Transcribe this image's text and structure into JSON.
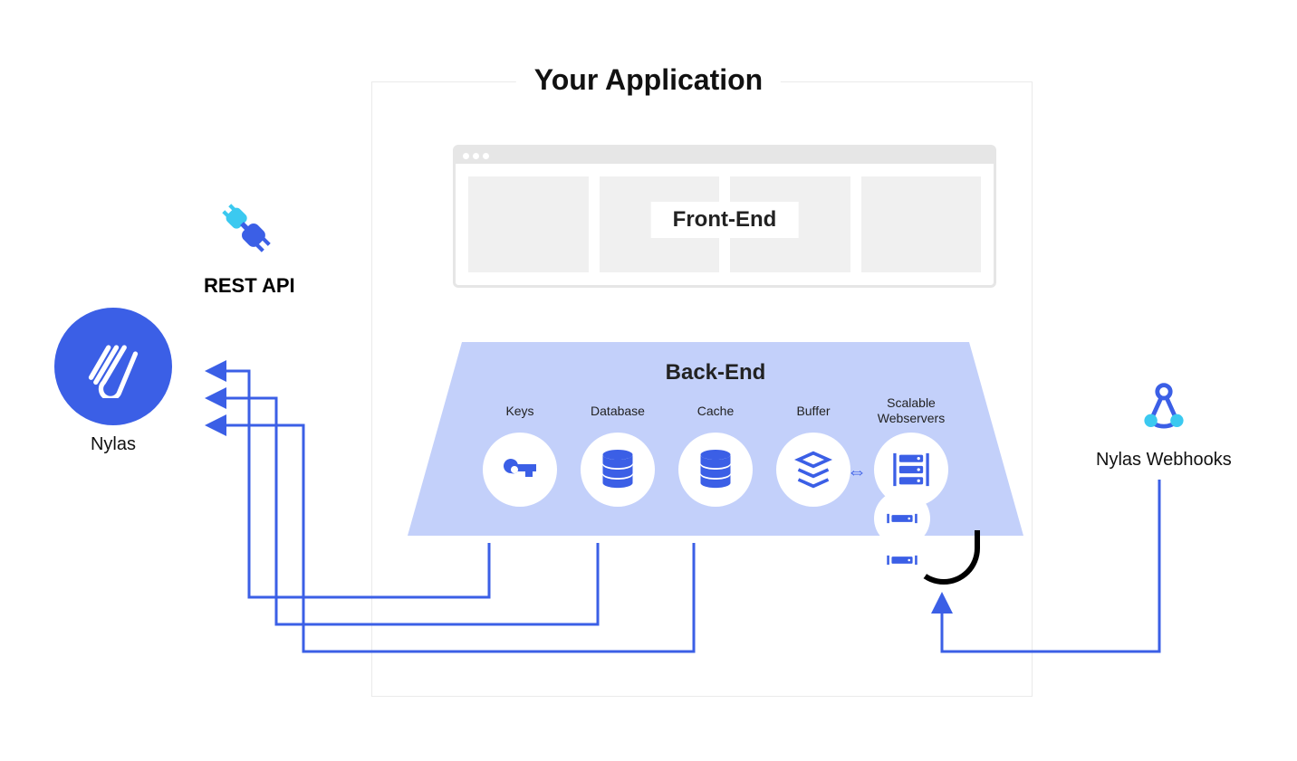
{
  "title": "Your Application",
  "frontend": {
    "label": "Front-End"
  },
  "backend": {
    "title": "Back-End",
    "items": [
      {
        "label": "Keys",
        "icon": "key"
      },
      {
        "label": "Database",
        "icon": "database"
      },
      {
        "label": "Cache",
        "icon": "database"
      },
      {
        "label": "Buffer",
        "icon": "layers"
      }
    ],
    "scalable": {
      "label": "Scalable\nWebservers",
      "icon": "servers"
    }
  },
  "nylas": {
    "label": "Nylas"
  },
  "rest_api": {
    "label": "REST API"
  },
  "webhooks": {
    "label": "Nylas Webhooks"
  },
  "colors": {
    "primary": "#3b5fe6",
    "accent": "#3bc9f0",
    "trapezoid": "#c3d0fa"
  }
}
